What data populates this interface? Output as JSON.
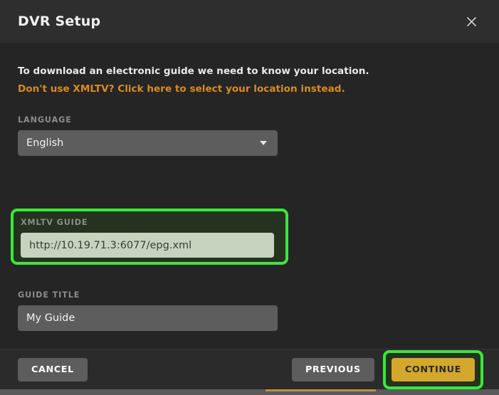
{
  "window": {
    "title": "DVR Setup",
    "close_icon": "close-icon"
  },
  "body": {
    "intro_text": "To download an electronic guide we need to know your location.",
    "intro_link": "Don't use XMLTV? Click here to select your location instead.",
    "fields": [
      {
        "label": "LANGUAGE",
        "type": "select",
        "value": "English",
        "options": [
          "English"
        ],
        "icon": "chevron-down-icon",
        "highlighted": false
      },
      {
        "label": "XMLTV GUIDE",
        "type": "text",
        "value": "http://10.19.71.3:6077/epg.xml",
        "placeholder": "",
        "highlighted": true
      },
      {
        "label": "GUIDE TITLE",
        "type": "text",
        "value": "My Guide",
        "placeholder": "",
        "highlighted": false
      }
    ]
  },
  "footer": {
    "cancel_label": "CANCEL",
    "previous_label": "PREVIOUS",
    "continue_label": "CONTINUE"
  },
  "colors": {
    "dialog_background": "#252525",
    "header_background": "#2e2e2e",
    "footer_background": "#2b2b2b",
    "highlight_green": "#3ae83a",
    "highlight_fill": "#24331f",
    "link_orange": "#d98b1f",
    "continue_gold": "#d4a82c",
    "input_gray": "#5d5d5d",
    "xmltv_input_fill": "#c6d4bf",
    "label_gray": "#8c8c8c",
    "progress_gold": "#c08f36"
  }
}
